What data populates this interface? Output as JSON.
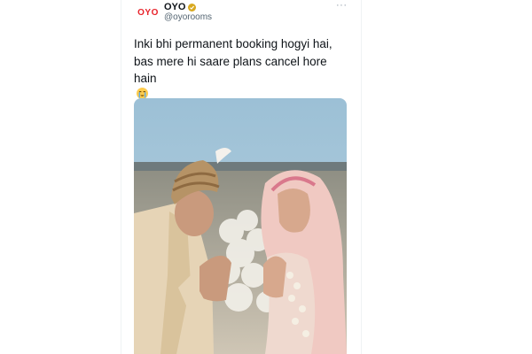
{
  "tweet": {
    "avatar_text": "OYO",
    "display_name": "OYO",
    "handle": "@oyorooms",
    "more_label": "···",
    "text_lines": [
      "Inki bhi permanent booking hogyi hai,",
      "bas mere hi saare plans cancel hore",
      "hain"
    ],
    "emoji_name": "loudly-crying-face-emoji",
    "verified_color": "#d8a920",
    "brand_color": "#e8232b",
    "photo_name": "wedding-photo"
  }
}
